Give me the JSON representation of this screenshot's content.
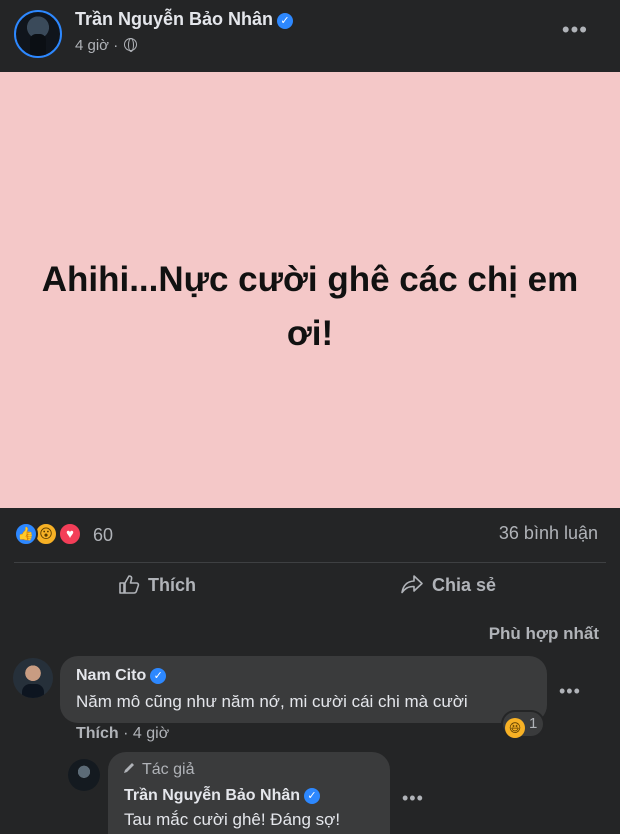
{
  "post": {
    "author": "Trần Nguyễn Bảo Nhân",
    "time": "4 giờ",
    "separator": "·",
    "text": "Ahihi...Nực cười ghê các chị em ơi!",
    "background_color": "#f4c8c8"
  },
  "stats": {
    "reaction_count": "60",
    "comment_count": "36 bình luận",
    "reactions": [
      "like",
      "wow",
      "love"
    ]
  },
  "actions": {
    "like_label": "Thích",
    "share_label": "Chia sẻ"
  },
  "comments": {
    "sort_label": "Phù hợp nhất",
    "items": [
      {
        "author": "Nam Cito",
        "text": "Năm mô cũng như năm nớ, mi cười cái chi mà cười",
        "like_label": "Thích",
        "time": "4 giờ",
        "reaction_count": "1",
        "reaction": "laughing-face"
      },
      {
        "tag": "Tác giả",
        "author": "Trần Nguyễn Bảo Nhân",
        "text": "Tau mắc cười ghê! Đáng sợ!"
      }
    ]
  },
  "colors": {
    "background": "#18191a",
    "surface": "#242526",
    "bubble": "#3a3b3c",
    "accent": "#2d88ff",
    "muted_text": "#b0b3b8"
  }
}
